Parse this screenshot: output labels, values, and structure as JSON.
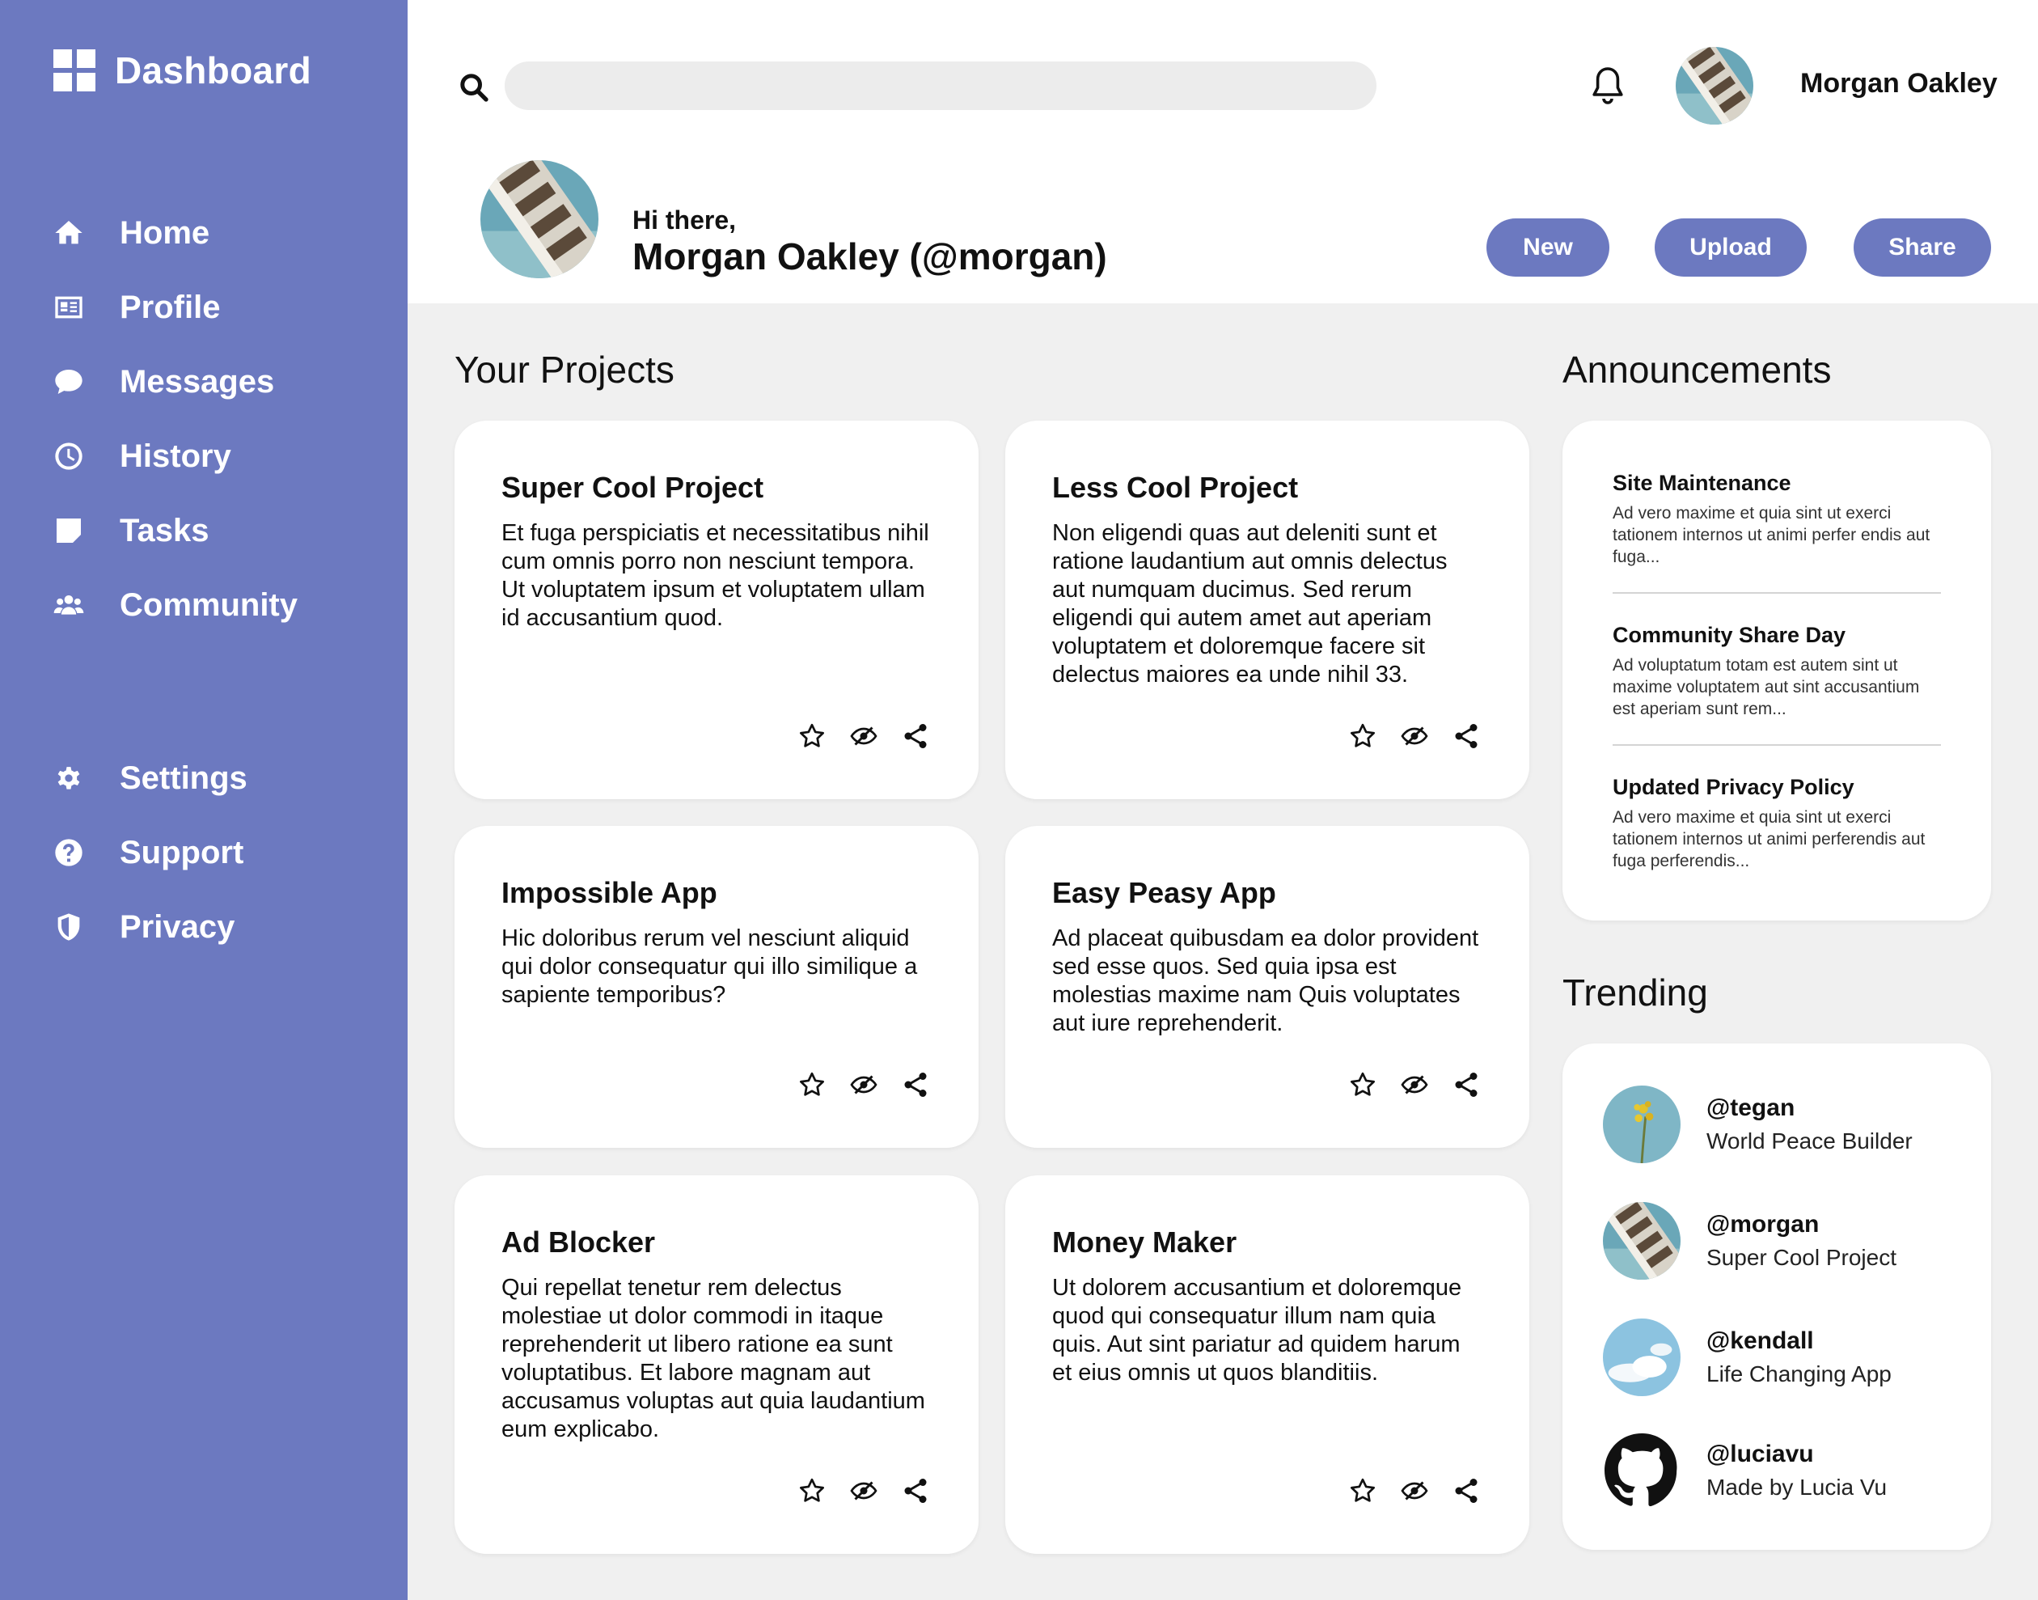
{
  "brand": {
    "title": "Dashboard"
  },
  "nav": {
    "top": [
      {
        "label": "Home",
        "icon": "home-icon"
      },
      {
        "label": "Profile",
        "icon": "id-card-icon"
      },
      {
        "label": "Messages",
        "icon": "speech-bubble-icon"
      },
      {
        "label": "History",
        "icon": "clock-icon"
      },
      {
        "label": "Tasks",
        "icon": "sticky-note-icon"
      },
      {
        "label": "Community",
        "icon": "users-icon"
      }
    ],
    "bottom": [
      {
        "label": "Settings",
        "icon": "gear-icon"
      },
      {
        "label": "Support",
        "icon": "question-icon"
      },
      {
        "label": "Privacy",
        "icon": "shield-icon"
      }
    ]
  },
  "header": {
    "search_placeholder": "",
    "username": "Morgan Oakley",
    "greeting": "Hi there,",
    "fullname": "Morgan Oakley (@morgan)",
    "buttons": {
      "new": "New",
      "upload": "Upload",
      "share": "Share"
    }
  },
  "projects": {
    "title": "Your Projects",
    "items": [
      {
        "title": "Super Cool Project",
        "desc": "Et fuga perspiciatis et necessitatibus nihil cum omnis porro non nesciunt tempora. Ut voluptatem ipsum et voluptatem ullam id accusantium quod."
      },
      {
        "title": "Less Cool Project",
        "desc": "Non eligendi quas aut deleniti sunt et ratione laudantium aut omnis delectus aut numquam ducimus. Sed rerum eligendi qui autem amet aut aperiam voluptatem et doloremque facere sit delectus maiores ea unde nihil 33."
      },
      {
        "title": "Impossible App",
        "desc": "Hic doloribus rerum vel nesciunt aliquid qui dolor consequatur qui illo similique a sapiente temporibus?"
      },
      {
        "title": "Easy Peasy App",
        "desc": "Ad placeat quibusdam ea dolor provident sed esse quos. Sed quia ipsa est molestias maxime nam Quis voluptates aut iure reprehenderit."
      },
      {
        "title": "Ad Blocker",
        "desc": "Qui repellat tenetur rem delectus molestiae ut dolor commodi in itaque reprehenderit ut libero ratione ea sunt voluptatibus. Et labore magnam aut accusamus voluptas aut quia laudantium eum explicabo."
      },
      {
        "title": "Money Maker",
        "desc": "Ut dolorem accusantium et doloremque quod qui consequatur illum nam quia quis. Aut sint pariatur ad quidem harum et eius omnis ut quos blanditiis."
      }
    ]
  },
  "announcements": {
    "title": "Announcements",
    "items": [
      {
        "title": "Site Maintenance",
        "body": "Ad vero maxime et quia sint ut exerci tationem internos ut animi perfer endis aut fuga..."
      },
      {
        "title": "Community Share Day",
        "body": "Ad voluptatum totam est autem sint ut maxime voluptatem aut sint accusantium est aperiam sunt rem..."
      },
      {
        "title": "Updated Privacy Policy",
        "body": "Ad vero maxime et quia sint ut exerci tationem internos ut animi perferendis aut fuga perferendis..."
      }
    ]
  },
  "trending": {
    "title": "Trending",
    "items": [
      {
        "handle": "@tegan",
        "sub": "World Peace Builder",
        "avatar": "flower-photo"
      },
      {
        "handle": "@morgan",
        "sub": "Super Cool Project",
        "avatar": "building-photo"
      },
      {
        "handle": "@kendall",
        "sub": "Life Changing App",
        "avatar": "sky-photo"
      },
      {
        "handle": "@luciavu",
        "sub": "Made by Lucia Vu",
        "avatar": "github-icon"
      }
    ]
  },
  "colors": {
    "accent": "#6c79c0",
    "background": "#f0f0f0",
    "card": "#ffffff"
  }
}
